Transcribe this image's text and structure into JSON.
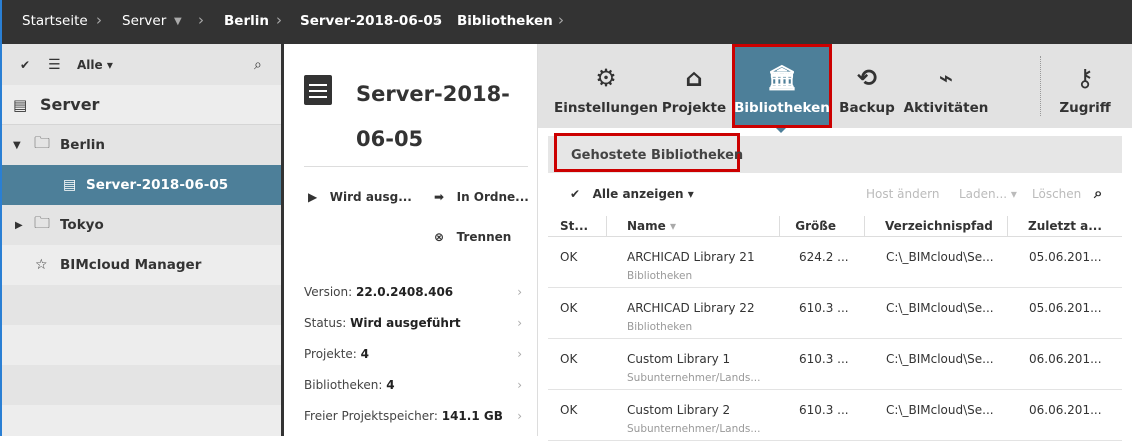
{
  "breadcrumb": [
    "Startseite",
    "Server",
    "Berlin",
    "Server-2018-06-05",
    "Bibliotheken"
  ],
  "sidebar": {
    "filter": "Alle",
    "root": "Server",
    "items": [
      {
        "label": "Berlin"
      },
      {
        "label": "Server-2018-06-05"
      },
      {
        "label": "Tokyo"
      },
      {
        "label": "BIMcloud Manager"
      }
    ]
  },
  "middle": {
    "title_line1": "Server-2018-",
    "title_line2": "06-05",
    "actions": {
      "run": "Wird ausg...",
      "ok": "In Ordne...",
      "disconnect": "Trennen"
    },
    "info": [
      {
        "label": "Version: ",
        "value": "22.0.2408.406"
      },
      {
        "label": "Status: ",
        "value": "Wird ausgeführt"
      },
      {
        "label": "Projekte: ",
        "value": "4"
      },
      {
        "label": "Bibliotheken: ",
        "value": "4"
      },
      {
        "label": "Freier Projektspeicher: ",
        "value": "141.1 GB"
      }
    ]
  },
  "tabs": [
    "Einstellungen",
    "Projekte",
    "Bibliotheken",
    "Backup",
    "Aktivitäten",
    "Zugriff"
  ],
  "section": "Gehostete Bibliotheken",
  "toolbar": {
    "show_all": "Alle anzeigen",
    "change_host": "Host ändern",
    "load": "Laden...",
    "delete": "Löschen"
  },
  "table": {
    "headers": [
      "St...",
      "Name",
      "Größe",
      "Verzeichnispfad",
      "Zuletzt a..."
    ],
    "rows": [
      {
        "status": "OK",
        "name": "ARCHICAD Library 21",
        "sub": "Bibliotheken",
        "size": "624.2 ...",
        "path": "C:\\_BIMcloud\\Se...",
        "date": "05.06.201..."
      },
      {
        "status": "OK",
        "name": "ARCHICAD Library 22",
        "sub": "Bibliotheken",
        "size": "610.3 ...",
        "path": "C:\\_BIMcloud\\Se...",
        "date": "05.06.201..."
      },
      {
        "status": "OK",
        "name": "Custom Library 1",
        "sub": "Subunternehmer/Lands...",
        "size": "610.3 ...",
        "path": "C:\\_BIMcloud\\Se...",
        "date": "06.06.201..."
      },
      {
        "status": "OK",
        "name": "Custom Library 2",
        "sub": "Subunternehmer/Lands...",
        "size": "610.3 ...",
        "path": "C:\\_BIMcloud\\Se...",
        "date": "06.06.201..."
      }
    ]
  }
}
